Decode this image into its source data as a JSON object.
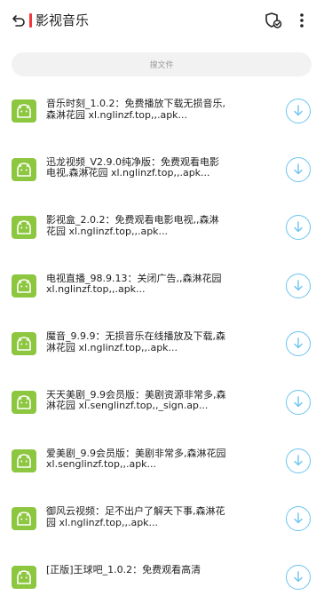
{
  "header": {
    "title": "影视音乐",
    "accent_color": "#f0393d",
    "back_icon": "back-arrow-icon",
    "shield_icon": "shield-check-icon",
    "more_icon": "more-vertical-icon"
  },
  "search": {
    "placeholder": "搜文件"
  },
  "colors": {
    "app_icon_bg": "#8dc63f",
    "download_accent": "#6cc4f0"
  },
  "items": [
    {
      "text": "音乐时刻_1.0.2：免费播放下载无损音乐,森淋花园 xl.nglinzf.top,,.apk...",
      "icon": "android-app-icon",
      "action_icon": "download-icon"
    },
    {
      "text": "迅龙视频_V2.9.0纯净版：免费观看电影电视,森淋花园 xl.nglinzf.top,,.apk...",
      "icon": "android-app-icon",
      "action_icon": "download-icon"
    },
    {
      "text": "影视盒_2.0.2：免费观看电影电视,,森淋花园 xl.nglinzf.top,,.apk...",
      "icon": "android-app-icon",
      "action_icon": "download-icon"
    },
    {
      "text": "电视直播_98.9.13：关闭广告,,森淋花园 xl.nglinzf.top,,.apk...",
      "icon": "android-app-icon",
      "action_icon": "download-icon"
    },
    {
      "text": "魔音_9.9.9：无损音乐在线播放及下载,森淋花园 xl.nglinzf.top,,.apk...",
      "icon": "android-app-icon",
      "action_icon": "download-icon"
    },
    {
      "text": "天天美剧_9.9会员版：美剧资源非常多,森淋花园 xl.senglinzf.top,,_sign.ap...",
      "icon": "android-app-icon",
      "action_icon": "download-icon"
    },
    {
      "text": "爱美剧_9.9会员版：美剧非常多,森淋花园 xl.senglinzf.top,,.apk...",
      "icon": "android-app-icon",
      "action_icon": "download-icon"
    },
    {
      "text": "御风云视频：足不出户了解天下事,森淋花园 xl.nglinzf.top,,.apk...",
      "icon": "android-app-icon",
      "action_icon": "download-icon"
    },
    {
      "text": "[正版]王球吧_1.0.2：免费观看高清",
      "icon": "android-app-icon",
      "action_icon": "download-icon"
    }
  ]
}
